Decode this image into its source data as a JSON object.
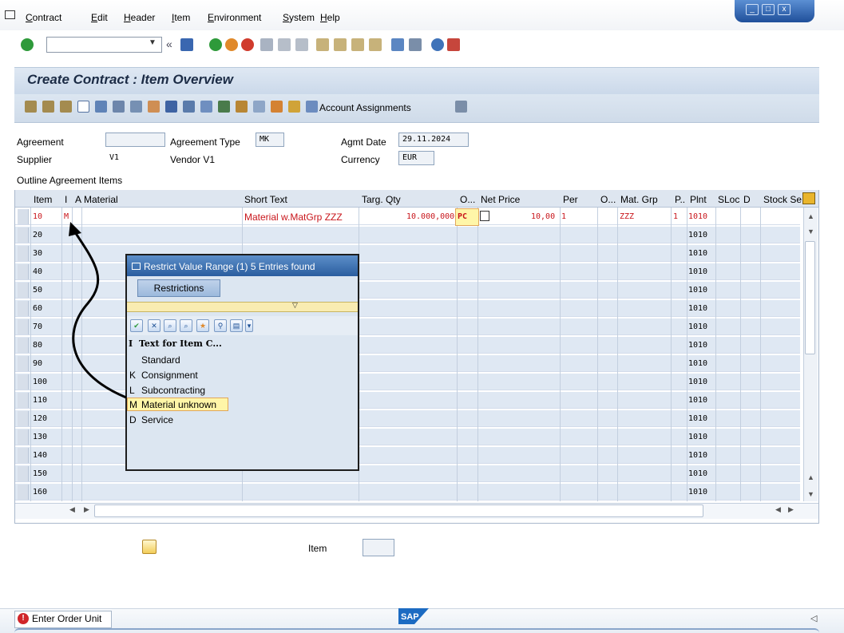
{
  "menu": {
    "items": [
      "Contract",
      "Edit",
      "Header",
      "Item",
      "Environment",
      "System",
      "Help"
    ]
  },
  "title": "Create Contract : Item Overview",
  "app_toolbar": {
    "account_assignments": "Account Assignments"
  },
  "header": {
    "agreement_label": "Agreement",
    "agreement_value": "",
    "agreement_type_label": "Agreement Type",
    "agreement_type_value": "MK",
    "agmt_date_label": "Agmt Date",
    "agmt_date_value": "29.11.2024",
    "supplier_label": "Supplier",
    "supplier_value": "V1",
    "supplier_name": "Vendor V1",
    "currency_label": "Currency",
    "currency_value": "EUR"
  },
  "section_title": "Outline Agreement Items",
  "table": {
    "columns": [
      "Item",
      "I",
      "A",
      "Material",
      "Short Text",
      "Targ. Qty",
      "O...",
      "Net Price",
      "Per",
      "O...",
      "Mat. Grp",
      "P..",
      "Plnt",
      "SLoc",
      "D",
      "Stock Se"
    ],
    "first_row": {
      "item": "10",
      "i": "M",
      "short_text": "Material w.MatGrp ZZZ",
      "targ_qty": "10.000,000",
      "order_unit": "PC",
      "net_price": "10,00",
      "per": "1",
      "mat_grp": "ZZZ",
      "p": "1",
      "plant": "1010"
    },
    "other_items": [
      "20",
      "30",
      "40",
      "50",
      "60",
      "70",
      "80",
      "90",
      "100",
      "110",
      "120",
      "130",
      "140",
      "150",
      "160"
    ],
    "other_plant": "1010"
  },
  "popup": {
    "title": "Restrict Value Range (1)   5 Entries found",
    "tab": "Restrictions",
    "list_header_key": "I",
    "list_header_text": "Text for Item C...",
    "entries": [
      {
        "key": "",
        "text": "Standard"
      },
      {
        "key": "K",
        "text": "Consignment"
      },
      {
        "key": "L",
        "text": "Subcontracting"
      },
      {
        "key": "M",
        "text": "Material unknown"
      },
      {
        "key": "D",
        "text": "Service"
      }
    ]
  },
  "lower": {
    "item_label": "Item",
    "item_value": ""
  },
  "status": {
    "message": "Enter Order Unit"
  },
  "logo_text": "SAP",
  "colors": {
    "accent_red": "#c8151b",
    "header_blue": "#dfe8f3",
    "highlight_yellow": "#fff6a8"
  }
}
